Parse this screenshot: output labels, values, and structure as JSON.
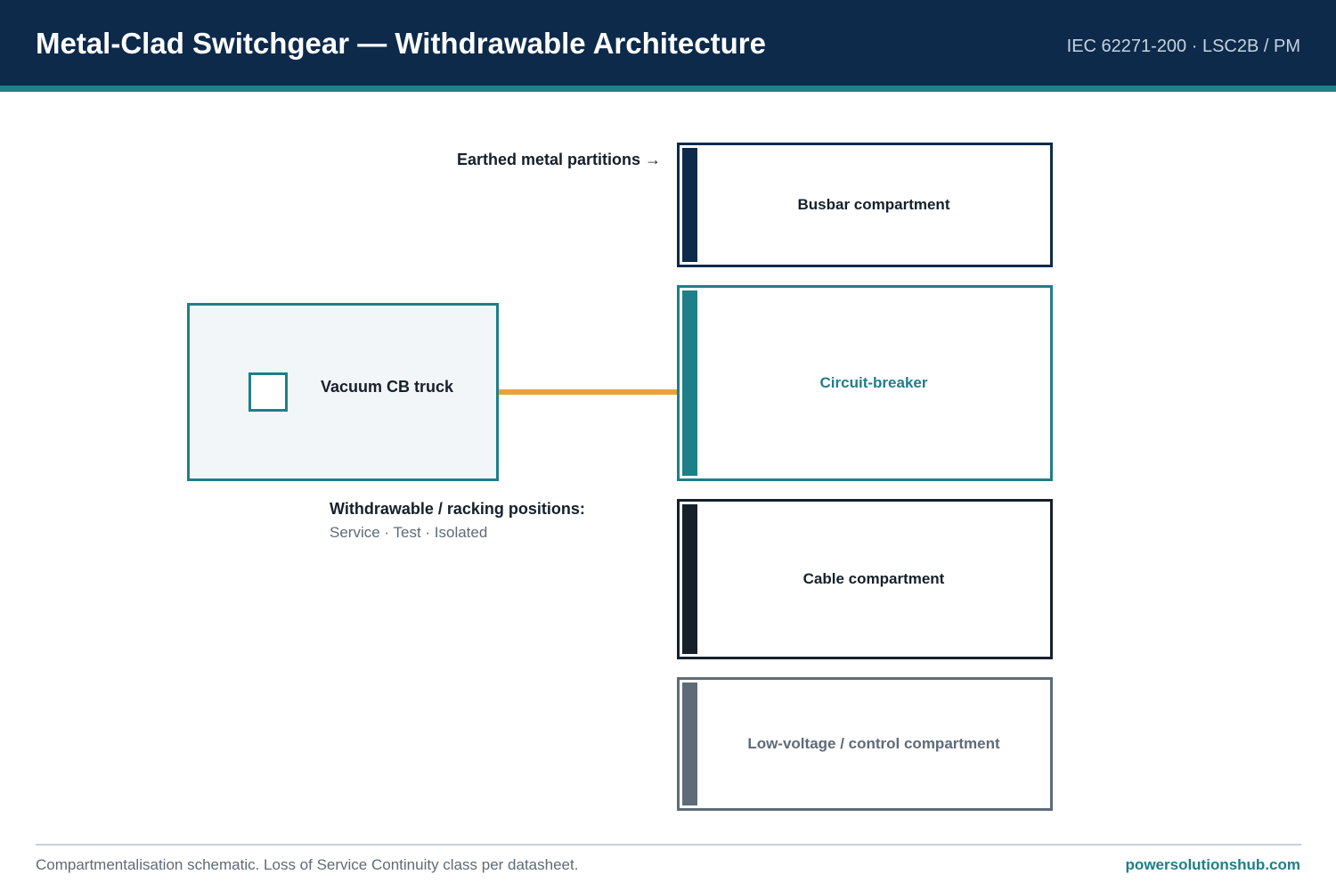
{
  "header": {
    "title": "Metal-Clad Switchgear — Withdrawable Architecture",
    "standard": "IEC 62271-200 · LSC2B / PM"
  },
  "diagram": {
    "partition_label": "Earthed metal partitions →",
    "compartments": [
      {
        "id": "busbar",
        "label": "Busbar compartment",
        "color": "#0d2a4a"
      },
      {
        "id": "circuit-breaker",
        "label": "Circuit-breaker",
        "color": "#1e7f88"
      },
      {
        "id": "cable",
        "label": "Cable compartment",
        "color": "#15202b"
      },
      {
        "id": "low-voltage",
        "label": "Low-voltage / control compartment",
        "color": "#5e6b78"
      }
    ],
    "truck": {
      "label": "Vacuum CB truck",
      "color": "#1e7f88"
    },
    "connector_color": "#e8a23a",
    "positions": {
      "title": "Withdrawable / racking positions:",
      "list": "Service · Test · Isolated"
    }
  },
  "footer": {
    "note": "Compartmentalisation schematic. Loss of Service Continuity class per datasheet.",
    "brand": "powersolutionshub.com"
  }
}
